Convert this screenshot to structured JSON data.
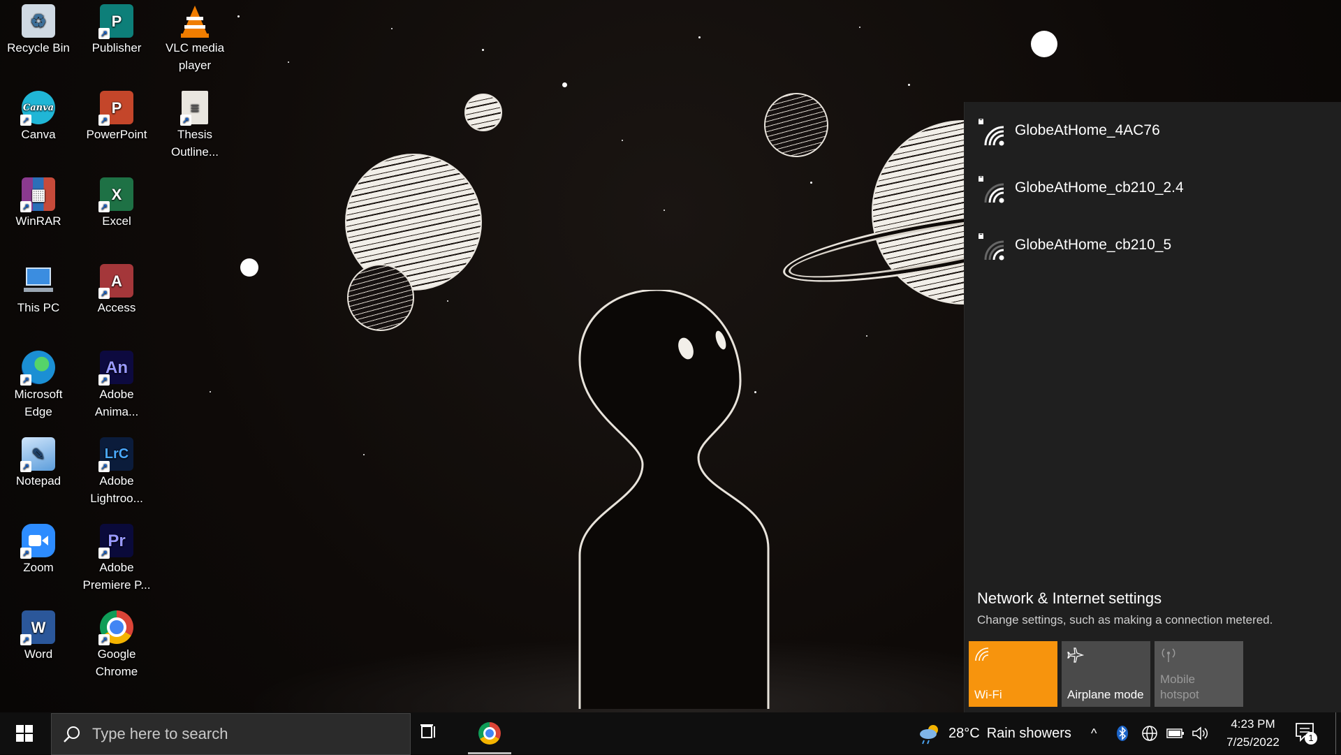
{
  "desktop_icons": [
    {
      "label": "Recycle Bin",
      "icon": "recycle-bin-icon",
      "color": "#9fb8cf"
    },
    {
      "label": "Publisher",
      "icon": "publisher-icon",
      "color": "#0d7f79"
    },
    {
      "label": "VLC media player",
      "icon": "vlc-icon",
      "color": "#f07d00"
    },
    {
      "label": "Canva",
      "icon": "canva-icon",
      "color": "#20b6d6"
    },
    {
      "label": "PowerPoint",
      "icon": "powerpoint-icon",
      "color": "#c4462a"
    },
    {
      "label": "Thesis Outline...",
      "icon": "document-icon",
      "color": "#e9e6df"
    },
    {
      "label": "WinRAR",
      "icon": "winrar-icon",
      "color": "#8a3a8f"
    },
    {
      "label": "Excel",
      "icon": "excel-icon",
      "color": "#1e7145"
    },
    {
      "label": "This PC",
      "icon": "computer-icon",
      "color": "#3b8de0"
    },
    {
      "label": "Access",
      "icon": "access-icon",
      "color": "#a4373a"
    },
    {
      "label": "Microsoft Edge",
      "icon": "edge-icon",
      "color": "#1b8fd4"
    },
    {
      "label": "Adobe Anima...",
      "icon": "adobe-animate-icon",
      "color": "#0d0a3f"
    },
    {
      "label": "Notepad",
      "icon": "notepad-icon",
      "color": "#7fb4e8"
    },
    {
      "label": "Adobe Lightroo...",
      "icon": "adobe-lightroom-icon",
      "color": "#0b1c3b"
    },
    {
      "label": "Zoom",
      "icon": "zoom-icon",
      "color": "#2d8cff"
    },
    {
      "label": "Adobe Premiere P...",
      "icon": "adobe-premiere-icon",
      "color": "#0a0a3a"
    },
    {
      "label": "Word",
      "icon": "word-icon",
      "color": "#2b579a"
    },
    {
      "label": "Google Chrome",
      "icon": "chrome-icon",
      "color": "#db4437"
    }
  ],
  "desktop_letters": {
    "publisher": "P",
    "powerpoint": "P",
    "excel": "X",
    "access": "A",
    "animate": "An",
    "lightroom": "LrC",
    "premiere": "Pr",
    "word": "W",
    "canva": "Canva"
  },
  "network_flyout": {
    "networks": [
      {
        "name": "GlobeAtHome_4AC76",
        "secured": true,
        "signal": 4
      },
      {
        "name": "GlobeAtHome_cb210_2.4",
        "secured": true,
        "signal": 3
      },
      {
        "name": "GlobeAtHome_cb210_5",
        "secured": true,
        "signal": 2
      }
    ],
    "settings_title": "Network & Internet settings",
    "settings_subtitle": "Change settings, such as making a connection metered.",
    "tiles": [
      {
        "label": "Wi-Fi",
        "state": "on",
        "icon": "wifi-icon",
        "bg": "#f7940d"
      },
      {
        "label": "Airplane mode",
        "state": "off",
        "icon": "airplane-icon",
        "bg": "#4a4a4a"
      },
      {
        "label": "Mobile hotspot",
        "state": "disabled",
        "icon": "hotspot-icon",
        "bg": "#555555"
      }
    ]
  },
  "taskbar": {
    "search_placeholder": "Type here to search",
    "weather_temp": "28°C",
    "weather_desc": "Rain showers",
    "time": "4:23 PM",
    "date": "7/25/2022",
    "notification_count": "1",
    "accent": "#f7940d"
  }
}
